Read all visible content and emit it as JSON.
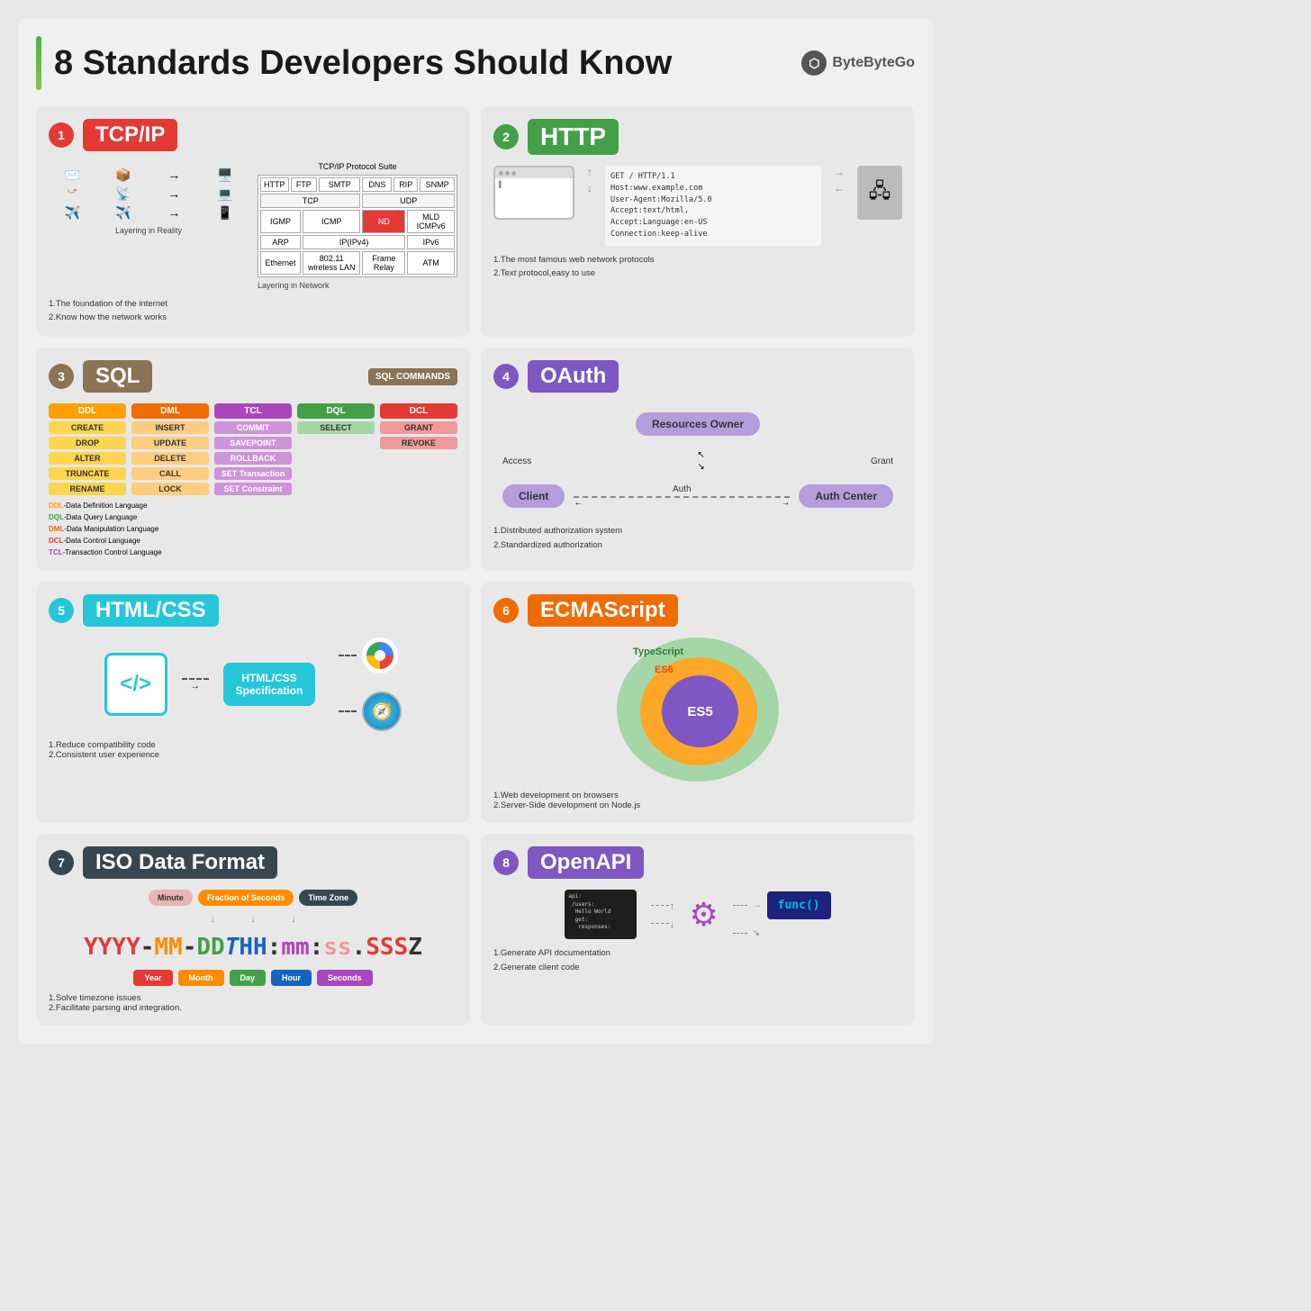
{
  "page": {
    "title": "8 Standards Developers Should Know",
    "logo": "ByteByteGo"
  },
  "cards": {
    "tcpip": {
      "number": "1",
      "title": "TCP/IP",
      "protocol_suite_label": "TCP/IP Protocol Suite",
      "layering_reality": "Layering in Reality",
      "layering_network": "Layering in Network",
      "footer1": "1.The foundation of the internet",
      "footer2": "2.Know how the network works"
    },
    "http": {
      "number": "2",
      "title": "HTTP",
      "code": "GET / HTTP/1.1\nHost:www.example.com\nUser-Agent:Mozilla/5.0\nAccept:text/html,\nAccept:Language:en-US\nConnection:keep-alive",
      "footer1": "1.The most famous web network protocols",
      "footer2": "2.Text protocol,easy to use"
    },
    "sql": {
      "number": "3",
      "title": "SQL",
      "commands_label": "SQL COMMANDS",
      "categories": [
        "DDL",
        "DML",
        "TCL",
        "DQL",
        "DCL"
      ],
      "ddl_items": [
        "CREATE",
        "DROP",
        "ALTER",
        "TRUNCATE",
        "RENAME"
      ],
      "dml_items": [
        "INSERT",
        "UPDATE",
        "DELETE",
        "CALL",
        "LOCK"
      ],
      "tcl_items": [
        "COMMIT",
        "SAVEPOINT",
        "ROLLBACK",
        "SET Transaction",
        "SET Constraint"
      ],
      "dql_items": [
        "SELECT"
      ],
      "dcl_items": [
        "GRANT",
        "REVOKE"
      ],
      "legend": [
        "DDL-Data Definition Language",
        "DQL-Data Query Language",
        "DML-Data Manipulation Language",
        "DCL-Data Control Language",
        "TCL-Transaction Control Language"
      ]
    },
    "oauth": {
      "number": "4",
      "title": "OAuth",
      "nodes": [
        "Resources Owner",
        "Client",
        "Auth Center"
      ],
      "labels": [
        "Access",
        "Grant",
        "Auth"
      ],
      "footer1": "1.Distributed authorization system",
      "footer2": "2.Standardized authorization"
    },
    "htmlcss": {
      "number": "5",
      "title": "HTML/CSS",
      "spec_label": "HTML/CSS\nSpecification",
      "code_symbol": "</>",
      "footer1": "1.Reduce compatibility code",
      "footer2": "2.Consistent user experience"
    },
    "ecmascript": {
      "number": "6",
      "title": "ECMAScript",
      "layers": [
        "TypeScript",
        "ES6",
        "ES5"
      ],
      "footer1": "1.Web development on browsers",
      "footer2": "2.Server-Side development on Node.js"
    },
    "iso": {
      "number": "7",
      "title": "ISO Data Format",
      "tags": [
        "Minute",
        "Fraction of Seconds",
        "Time Zone"
      ],
      "datetime_display": "YYYY-MM-DDTHH:mm:ss.SSSZ",
      "labels": [
        "Year",
        "Month",
        "Day",
        "Hour",
        "Seconds"
      ],
      "footer1": "1.Solve timezone issues",
      "footer2": "2.Facilitate parsing and integration."
    },
    "openapi": {
      "number": "8",
      "title": "OpenAPI",
      "func_label": "func()",
      "terminal_text": "api:\n  /users:\n    Hello World\n    get:\n      responses:",
      "footer1": "1.Generate API documentation",
      "footer2": "2.Generate client code"
    }
  }
}
